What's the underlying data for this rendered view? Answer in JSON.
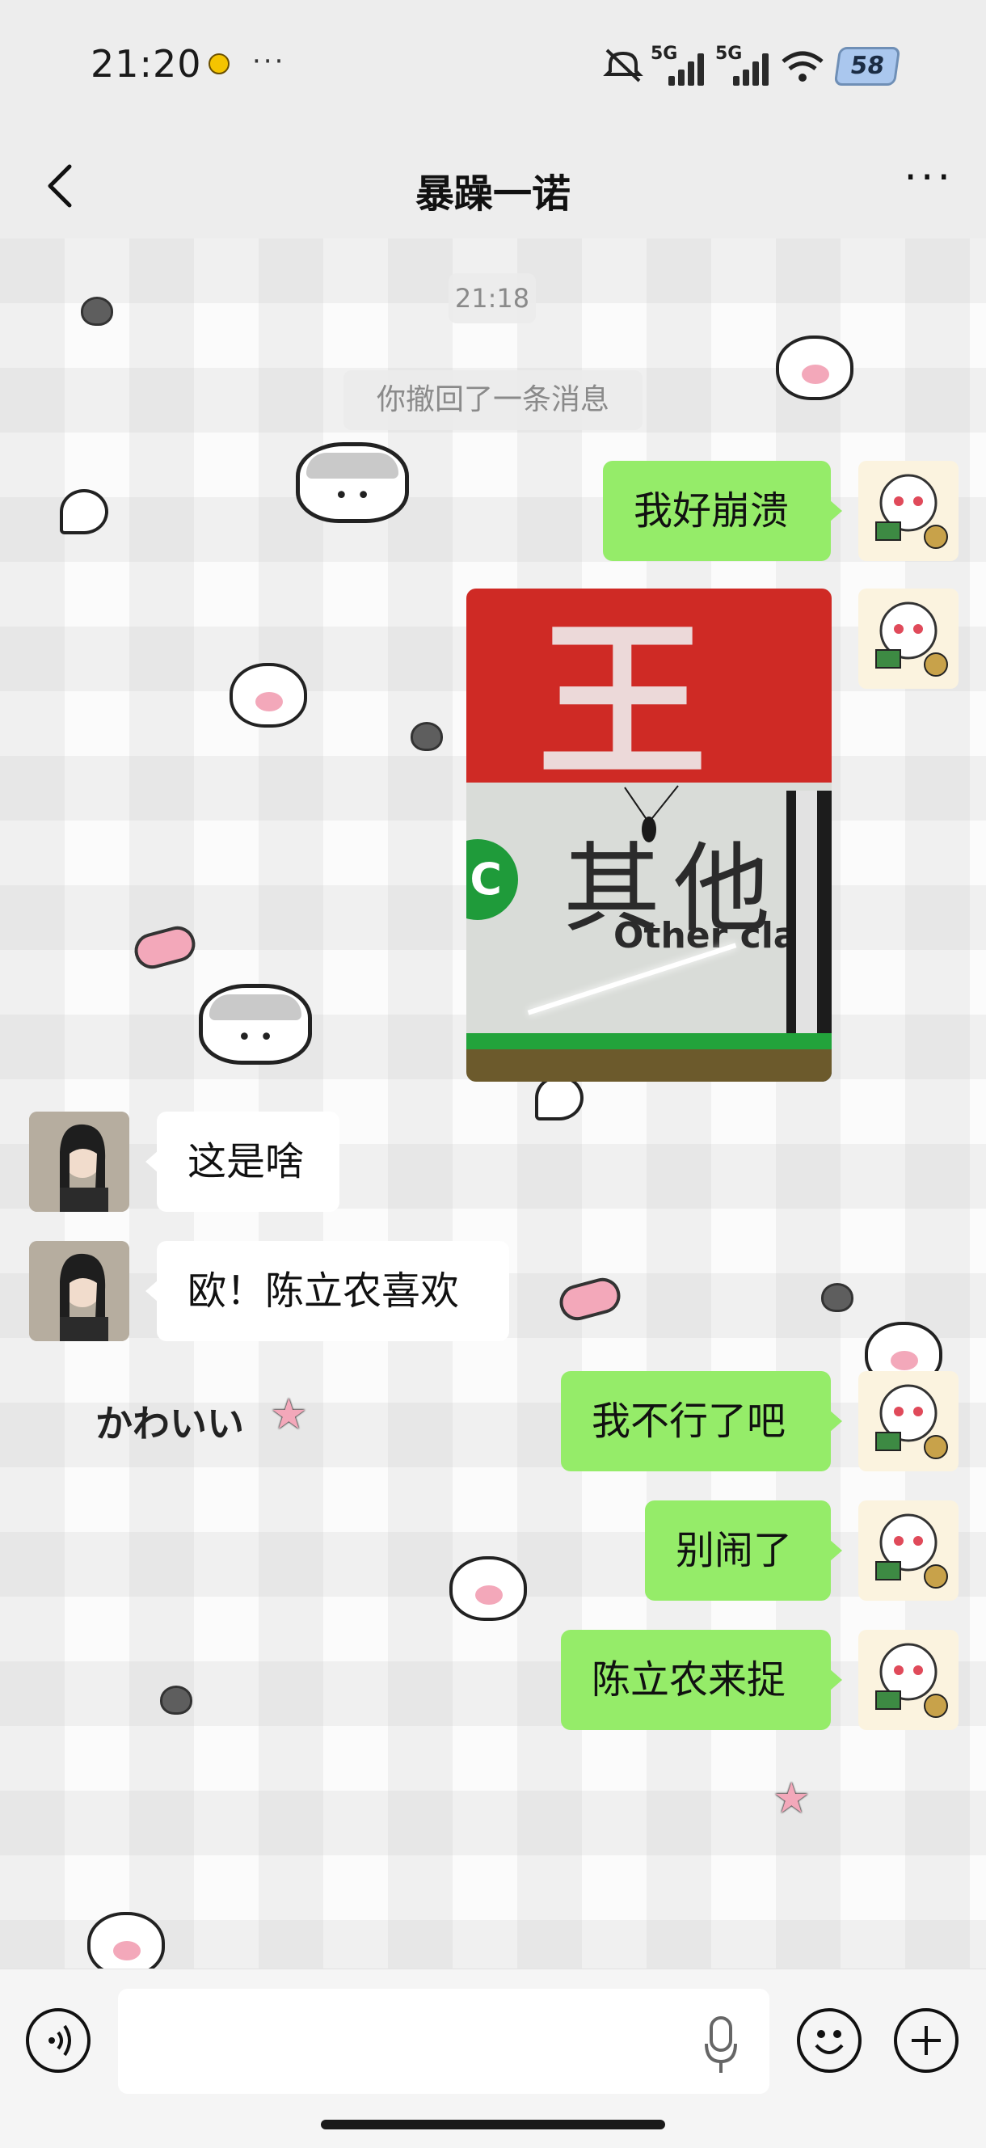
{
  "status_bar": {
    "time": "21:20",
    "dots": "···",
    "network_1": "5G",
    "network_2": "5G",
    "battery": "58"
  },
  "header": {
    "title": "暴躁一诺",
    "back_icon": "chevron-left-icon",
    "more_label": "···"
  },
  "chat": {
    "timestamp": "21:18",
    "system_notice": "你撤回了一条消息",
    "messages": [
      {
        "sender": "me",
        "text": "我好崩溃"
      },
      {
        "sender": "me",
        "type": "image",
        "photo_sign_cn": "其他",
        "photo_sign_en": "Other clas",
        "photo_circle": "C"
      },
      {
        "sender": "other",
        "text": "这是啥"
      },
      {
        "sender": "other",
        "text": "欧！陈立农喜欢"
      },
      {
        "sender": "me",
        "text": "我不行了吧"
      },
      {
        "sender": "me",
        "text": "别闹了"
      },
      {
        "sender": "me",
        "text": "陈立农来捉"
      }
    ]
  },
  "background_sticker_text": "かわいい",
  "input_bar": {
    "voice_icon": "voice-wave-icon",
    "mic_icon": "microphone-icon",
    "emoji_icon": "smiley-icon",
    "plus_icon": "plus-icon"
  },
  "colors": {
    "my_bubble": "#95ec69",
    "other_bubble": "#ffffff",
    "bar_bg": "#ededed"
  }
}
